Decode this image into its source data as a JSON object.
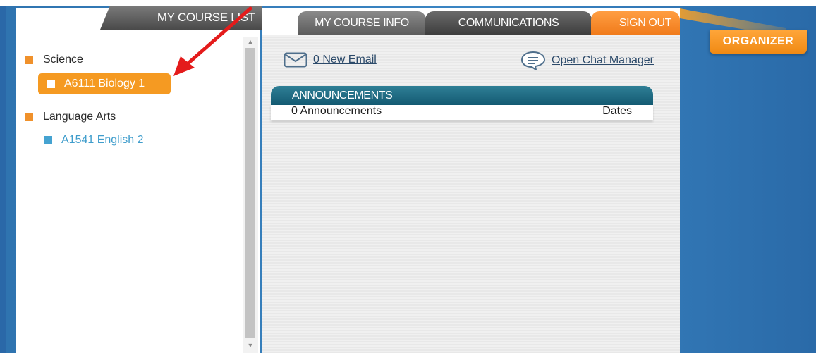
{
  "tabs": {
    "my_course_list": "MY COURSE LIST",
    "my_course_info": "MY COURSE INFO",
    "communications": "COMMUNICATIONS",
    "sign_out": "SIGN OUT"
  },
  "organizer": {
    "label": "ORGANIZER"
  },
  "course_list": {
    "groups": [
      {
        "label": "Science"
      },
      {
        "label": "Language Arts"
      }
    ],
    "courses": [
      {
        "label": "A6111 Biology 1",
        "selected": true
      },
      {
        "label": "A1541 English 2",
        "selected": false
      }
    ]
  },
  "communications": {
    "email_label": "0 New Email",
    "chat_label": "Open Chat Manager"
  },
  "announcements": {
    "header": "ANNOUNCEMENTS",
    "count_label": "0 Announcements",
    "dates_label": "Dates"
  },
  "colors": {
    "accent_orange": "#f59a22",
    "link_blue": "#3f9dcc",
    "header_teal": "#145a72",
    "annotation_red": "#e41b1b"
  }
}
